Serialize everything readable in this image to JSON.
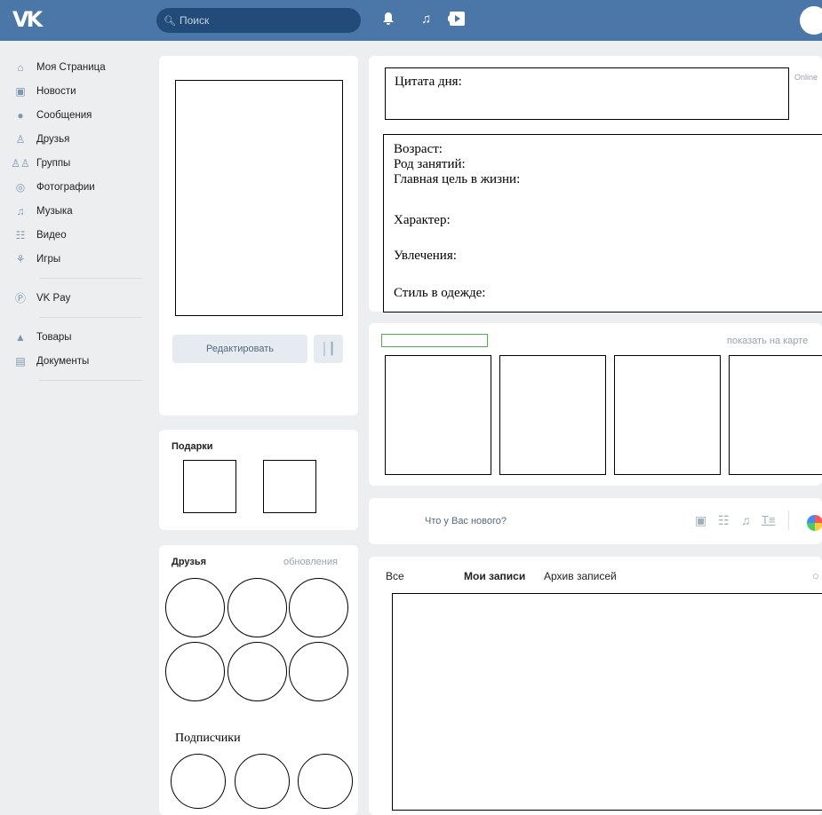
{
  "header": {
    "logo": "VK",
    "search_placeholder": "Поиск",
    "icons": [
      "bell-icon",
      "music-icon",
      "video-play-icon"
    ]
  },
  "sidebar": {
    "items": [
      {
        "label": "Моя Страница",
        "icon": "house-icon"
      },
      {
        "label": "Новости",
        "icon": "news-icon"
      },
      {
        "label": "Сообщения",
        "icon": "messages-icon"
      },
      {
        "label": "Друзья",
        "icon": "friend-icon"
      },
      {
        "label": "Группы",
        "icon": "groups-icon"
      },
      {
        "label": "Фотографии",
        "icon": "camera-icon"
      },
      {
        "label": "Музыка",
        "icon": "music-icon"
      },
      {
        "label": "Видео",
        "icon": "video-icon"
      },
      {
        "label": "Игры",
        "icon": "gamepad-icon"
      }
    ],
    "pay": {
      "label": "VK Pay",
      "icon": "vkpay-icon"
    },
    "extra": [
      {
        "label": "Товары",
        "icon": "bag-icon"
      },
      {
        "label": "Документы",
        "icon": "document-icon"
      }
    ]
  },
  "profile": {
    "edit_button": "Редактировать"
  },
  "gifts": {
    "title": "Подарки"
  },
  "friends": {
    "title": "Друзья",
    "updates_link": "обновления"
  },
  "subscribers": {
    "title": "Подписчики"
  },
  "quote": {
    "label": "Цитата дня:",
    "status": "Online"
  },
  "info": {
    "age": "Возраст:",
    "occupation": "Род занятий:",
    "goal": "Главная цель в жизни:",
    "character": "Характер:",
    "hobbies": "Увлечения:",
    "style": "Стиль в одежде:"
  },
  "photos": {
    "show_on_map": "показать на карте"
  },
  "composer": {
    "placeholder": "Что у Вас нового?"
  },
  "wall": {
    "tabs": [
      "Все",
      "Мои записи",
      "Архив записей"
    ],
    "search_icon": "search-icon"
  },
  "colors": {
    "header": "#4a76a8",
    "background": "#edeef0",
    "accent_green": "#4bb34b"
  }
}
